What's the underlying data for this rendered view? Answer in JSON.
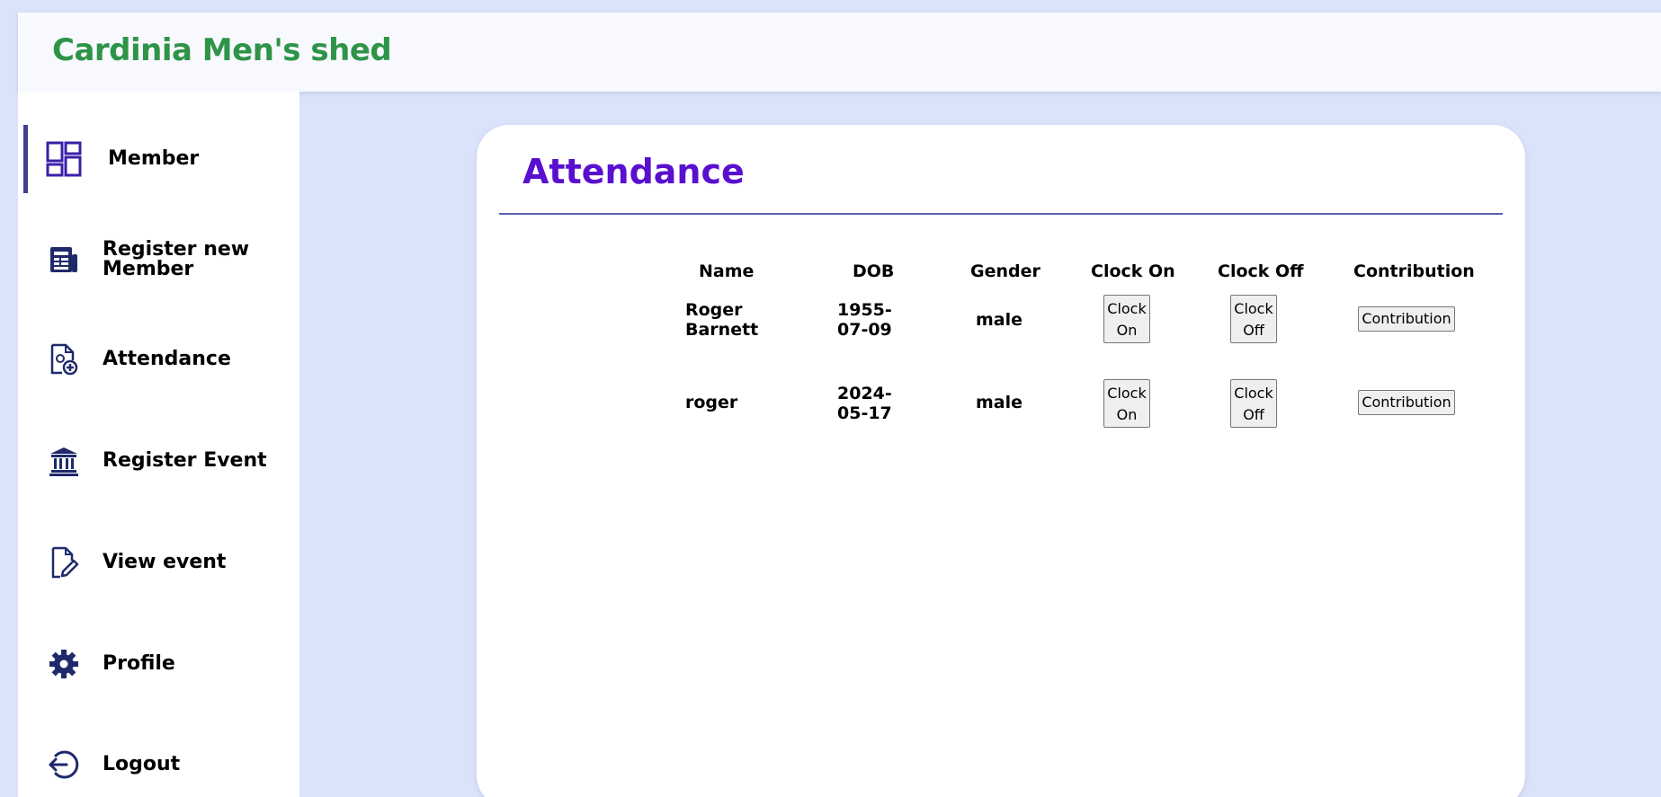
{
  "header": {
    "brand": "Cardinia Men's shed"
  },
  "sidebar": {
    "items": [
      {
        "label": "Member",
        "icon": "dashboard-grid-icon",
        "active": true
      },
      {
        "label": "Register new Member",
        "icon": "newspaper-icon"
      },
      {
        "label": "Attendance",
        "icon": "document-add-icon"
      },
      {
        "label": "Register Event",
        "icon": "bank-building-icon"
      },
      {
        "label": "View event",
        "icon": "document-edit-icon"
      },
      {
        "label": "Profile",
        "icon": "gear-icon"
      },
      {
        "label": "Logout",
        "icon": "logout-icon"
      }
    ]
  },
  "main": {
    "title": "Attendance",
    "columns": [
      "Name",
      "DOB",
      "Gender",
      "Clock On",
      "Clock Off",
      "Contribution"
    ],
    "rows": [
      {
        "name": "Roger Barnett",
        "dob": "1955-07-09",
        "gender": "male",
        "clock_on": "Clock On",
        "clock_off": "Clock Off",
        "contribution": "Contribution"
      },
      {
        "name": "roger",
        "dob": "2024-05-17",
        "gender": "male",
        "clock_on": "Clock On",
        "clock_off": "Clock Off",
        "contribution": "Contribution"
      }
    ]
  },
  "colors": {
    "brand": "#2e9448",
    "title": "#5a0fcf",
    "background": "#dbe3fb",
    "icon": "#1f2a6b"
  }
}
